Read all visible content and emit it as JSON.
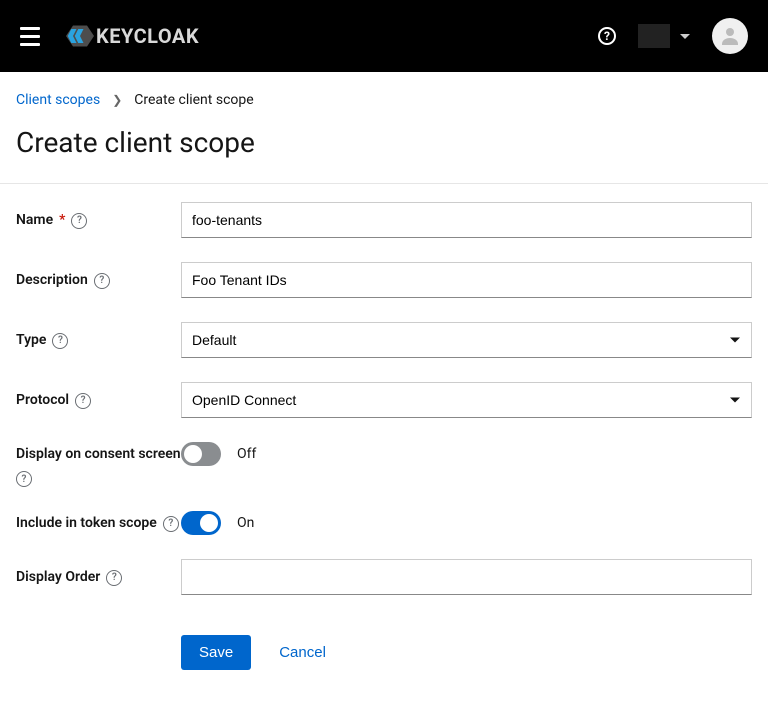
{
  "header": {
    "brand": "KEYCLOAK"
  },
  "breadcrumb": {
    "parent": "Client scopes",
    "current": "Create client scope"
  },
  "title": "Create client scope",
  "form": {
    "name": {
      "label": "Name",
      "value": "foo-tenants"
    },
    "description": {
      "label": "Description",
      "value": "Foo Tenant IDs"
    },
    "type": {
      "label": "Type",
      "value": "Default"
    },
    "protocol": {
      "label": "Protocol",
      "value": "OpenID Connect"
    },
    "display_consent": {
      "label": "Display on consent screen",
      "value": "Off",
      "on": false
    },
    "include_token": {
      "label": "Include in token scope",
      "value": "On",
      "on": true
    },
    "display_order": {
      "label": "Display Order",
      "value": ""
    },
    "save": "Save",
    "cancel": "Cancel"
  }
}
